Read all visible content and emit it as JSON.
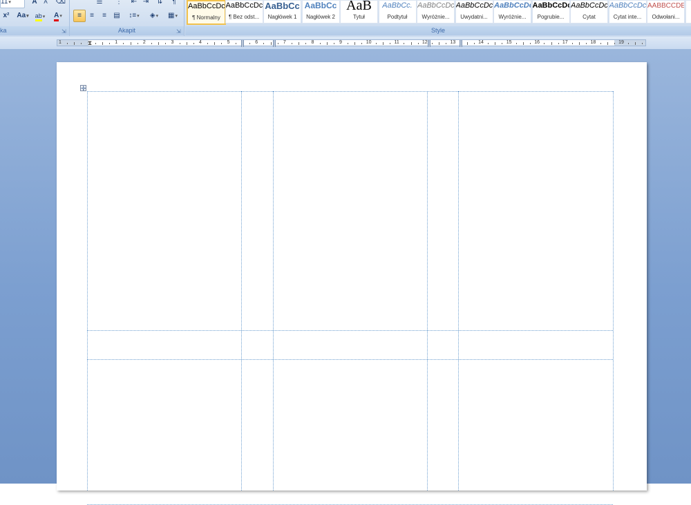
{
  "ribbon": {
    "font_group": {
      "label": "ka",
      "font_size": "11",
      "grow_font_icon": "A",
      "shrink_font_icon": "A",
      "superscript": "x²",
      "change_case": "Aa",
      "highlight_icon": "ab",
      "font_color_icon": "A"
    },
    "paragraph_group": {
      "label": "Akapit"
    },
    "styles_group": {
      "label": "Style",
      "items": [
        {
          "sample": "AaBbCcDc",
          "name": "¶ Normalny"
        },
        {
          "sample": "AaBbCcDc",
          "name": "¶ Bez odst..."
        },
        {
          "sample": "AaBbCc",
          "name": "Nagłówek 1"
        },
        {
          "sample": "AaBbCc",
          "name": "Nagłówek 2"
        },
        {
          "sample": "AaB",
          "name": "Tytuł"
        },
        {
          "sample": "AaBbCc.",
          "name": "Podtytuł"
        },
        {
          "sample": "AaBbCcDc",
          "name": "Wyróżnie..."
        },
        {
          "sample": "AaBbCcDc",
          "name": "Uwydatni..."
        },
        {
          "sample": "AaBbCcDc",
          "name": "Wyróżnie..."
        },
        {
          "sample": "AaBbCcDc",
          "name": "Pogrubie..."
        },
        {
          "sample": "AaBbCcDc",
          "name": "Cytat"
        },
        {
          "sample": "AaBbCcDc",
          "name": "Cytat inte..."
        },
        {
          "sample": "AABBCCDE",
          "name": "Odwołani..."
        },
        {
          "sample": "A",
          "name": ""
        }
      ]
    }
  },
  "ruler": {
    "numbers": [
      "1",
      "·",
      "1",
      "2",
      "3",
      "4",
      "5",
      "6",
      "7",
      "8",
      "9",
      "10",
      "11",
      "12",
      "13",
      "14",
      "15",
      "16",
      "17",
      "18",
      "19"
    ]
  },
  "colors": {
    "ribbon_bg": "#dfe9f5",
    "workspace_bg": "#7c9fd0",
    "gridline": "#6e9fd0",
    "selected_style_border": "#f2c24c",
    "heading_blue": "#365f91"
  }
}
